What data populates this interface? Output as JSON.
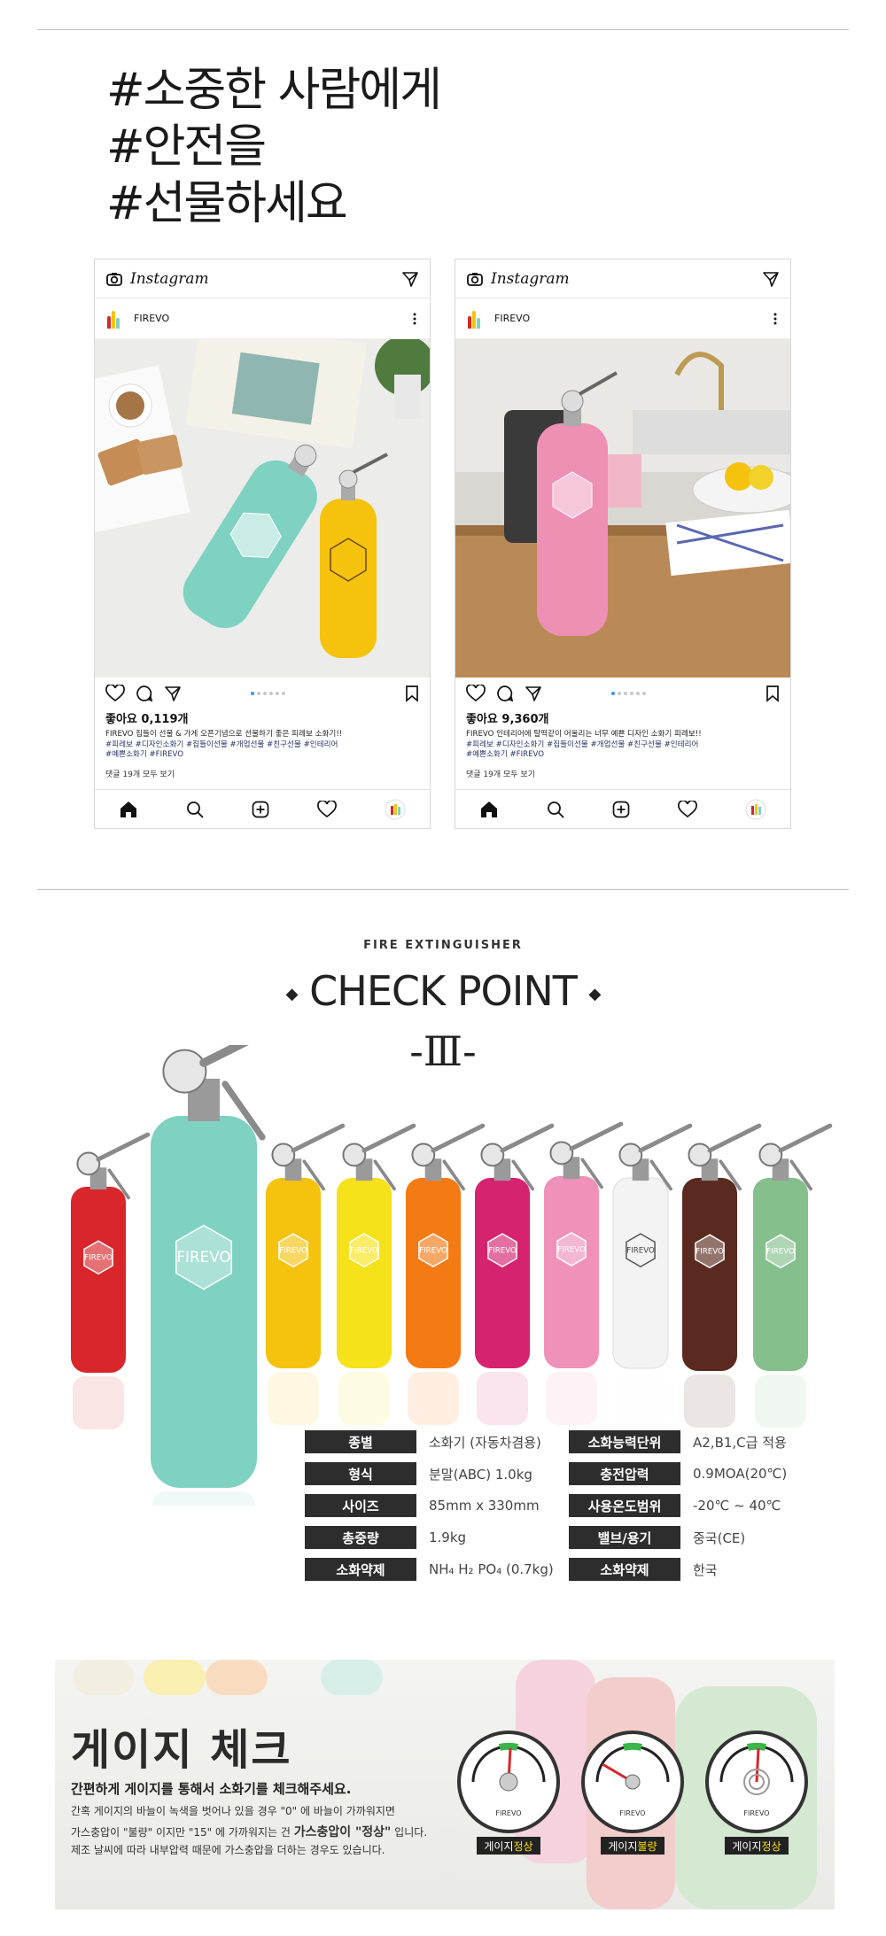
{
  "headline": {
    "line1": "#소중한 사람에게",
    "line2": "#안전을",
    "line3": "#선물하세요"
  },
  "instagram": [
    {
      "app": "Instagram",
      "user": "FIREVO",
      "likes": "좋아요 0,119개",
      "caption": "FIREVO 집들이 선물 & 가게 오픈기념으로 선물하기 좋은 피레보 소화기!!",
      "tags1": "#피레보 #디자인소화기 #집들이선물 #개업선물 #친구선물 #인테리어",
      "tags2": "#예쁜소화기 #FIREVO",
      "comments": "댓글 19개 모두 보기"
    },
    {
      "app": "Instagram",
      "user": "FIREVO",
      "likes": "좋아요 9,360개",
      "caption": "FIREVO 인테리어에 탈떡같이 어울리는 너무 예쁜 디자인 소화기 피레보!!",
      "tags1": "#피레보 #디자인소화기 #집들이선물 #개업선물 #친구선물 #인테리어",
      "tags2": "#예쁜소화기 #FIREVO",
      "comments": "댓글 19개 모두 보기"
    }
  ],
  "checkpoint": {
    "arc": "FIRE EXTINGUISHER",
    "title": "CHECK POINT",
    "roman": "-Ⅲ-"
  },
  "extinguisher_colors": [
    "#d8262a",
    "#7fd1c2",
    "#f5c20e",
    "#f5e21a",
    "#f47a14",
    "#d6236f",
    "#ef91b8",
    "#f3f3f3",
    "#5a2a20",
    "#85c08c"
  ],
  "brand": "FIREVO",
  "specs_left": [
    {
      "key": "종별",
      "value": "소화기 (자동차겸용)"
    },
    {
      "key": "형식",
      "value": "분말(ABC) 1.0kg"
    },
    {
      "key": "사이즈",
      "value": "85mm x 330mm"
    },
    {
      "key": "총중량",
      "value": "1.9kg"
    },
    {
      "key": "소화약제",
      "value": "NH₄ H₂ PO₄ (0.7kg)"
    }
  ],
  "specs_right": [
    {
      "key": "소화능력단위",
      "value": "A2,B1,C급 적용"
    },
    {
      "key": "충전압력",
      "value": "0.9MOA(20℃)"
    },
    {
      "key": "사용온도범위",
      "value": "-20℃ ~ 40℃"
    },
    {
      "key": "밸브/용기",
      "value": "중국(CE)"
    },
    {
      "key": "소화약제",
      "value": "한국"
    }
  ],
  "gauge": {
    "title": "게이지 체크",
    "subtitle": "간편하게 게이지를 통해서 소화기를 체크해주세요.",
    "p1": "간혹 게이지의 바늘이 녹색을 벗어나 있을 경우 \"0\" 에 바늘이 가까워지면",
    "p2a": "가스충압이 \"불량\" 이지만 \"15\" 에 가까워지는 건 ",
    "p2b": "가스충압이 \"정상\"",
    "p2c": " 입니다.",
    "p3": "제조 날씨에 따라 내부압력 때문에 가스충압을 더하는 경우도 있습니다.",
    "items": [
      {
        "prefix": "게이지 ",
        "status": "정상"
      },
      {
        "prefix": "게이지 ",
        "status": "불량"
      },
      {
        "prefix": "게이지 ",
        "status": "정상"
      }
    ]
  }
}
